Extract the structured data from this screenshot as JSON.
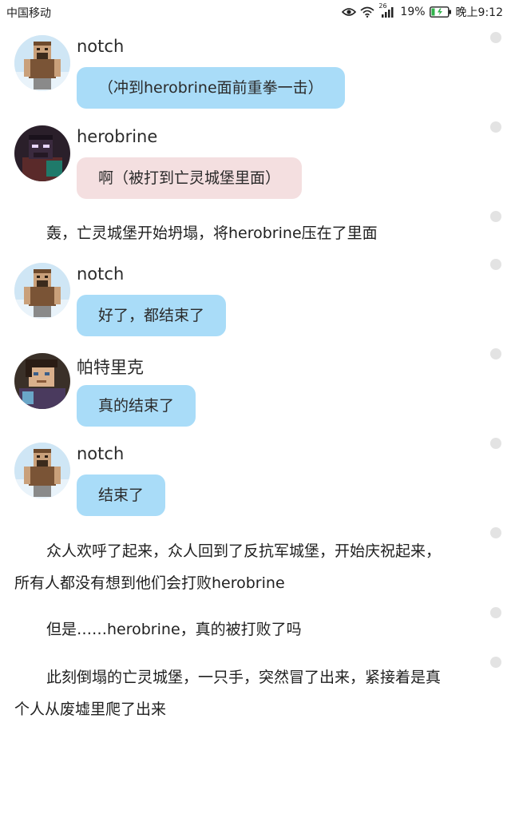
{
  "status_bar": {
    "carrier": "中国移动",
    "network_badge": "26",
    "battery": "19%",
    "time": "晚上9:12"
  },
  "messages": [
    {
      "name": "notch",
      "text": "（冲到herobrine面前重拳一击）",
      "avatar": "notch-avatar-icon",
      "bubble_color": "#a9dcf8"
    },
    {
      "name": "herobrine",
      "text": "啊（被打到亡灵城堡里面）",
      "avatar": "herobrine-avatar-icon",
      "bubble_color": "#f4dfe0"
    },
    {
      "name": "notch",
      "text": "好了，都结束了",
      "avatar": "notch-avatar-icon",
      "bubble_color": "#a9dcf8"
    },
    {
      "name": "帕特里克",
      "text": "真的结束了",
      "avatar": "patrick-avatar-icon",
      "bubble_color": "#a9dcf8"
    },
    {
      "name": "notch",
      "text": "结束了",
      "avatar": "notch-avatar-icon",
      "bubble_color": "#a9dcf8"
    }
  ],
  "narration": [
    {
      "line1": "轰，亡灵城堡开始坍塌，将herobrine压在了里面"
    },
    {
      "line1": "众人欢呼了起来，众人回到了反抗军城堡，开始庆祝起来，",
      "line2": "所有人都没有想到他们会打败herobrine"
    },
    {
      "line1": "但是……herobrine，真的被打败了吗"
    },
    {
      "line1": "此刻倒塌的亡灵城堡，一只手，突然冒了出来，紧接着是真",
      "line2": "个人从废墟里爬了出来"
    }
  ]
}
